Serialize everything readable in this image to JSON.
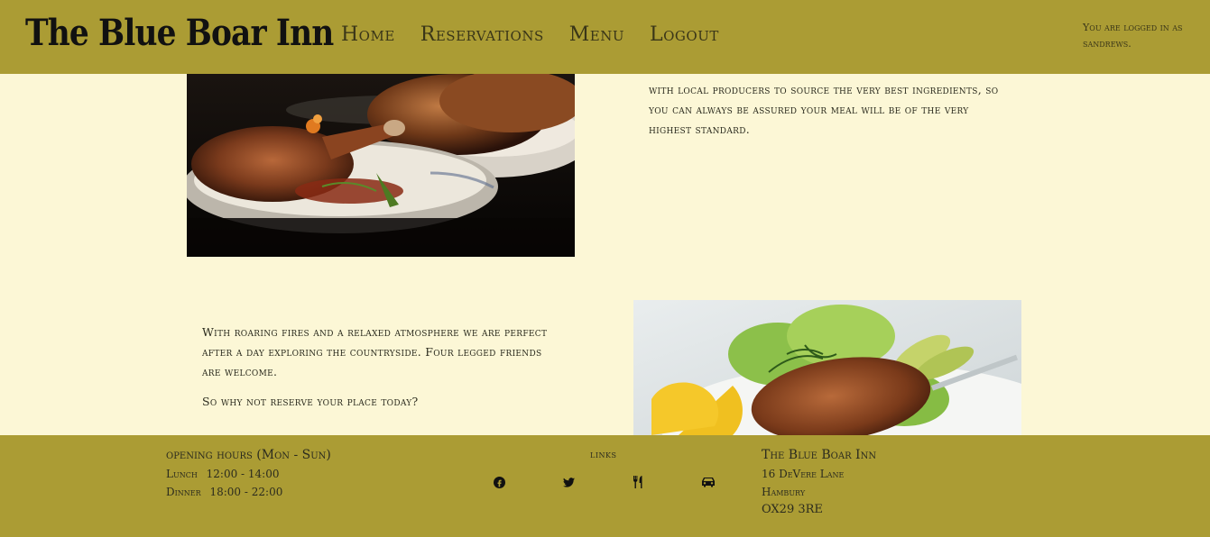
{
  "header": {
    "brand": "The Blue Boar Inn",
    "nav": [
      "Home",
      "Reservations",
      "Menu",
      "Logout"
    ],
    "login_status": "You are logged in as sandrews."
  },
  "main": {
    "top_text": "with local producers to source the very best ingredients, so you can always be assured your meal will be of the very highest standard.",
    "bottom_paragraphs": [
      "With roaring fires and a relaxed atmosphere we are perfect after a day exploring the countryside. Four legged friends are welcome.",
      "So why not reserve your place today?"
    ]
  },
  "footer": {
    "hours": {
      "heading": "opening hours (Mon - Sun)",
      "lunch_label": "Lunch",
      "lunch_time": "12:00 - 14:00",
      "dinner_label": "Dinner",
      "dinner_time": "18:00 - 22:00"
    },
    "links": {
      "heading": "links",
      "icons": [
        "facebook-icon",
        "twitter-icon",
        "utensils-icon",
        "car-icon"
      ]
    },
    "address": {
      "name": "The Blue Boar Inn",
      "street": "16 DeVere Lane",
      "town": "Hambury",
      "postcode": "OX29 3RE"
    }
  },
  "colors": {
    "header_footer": "#ab9c34",
    "background": "#fcf7d6",
    "text": "#2b2b1e"
  }
}
